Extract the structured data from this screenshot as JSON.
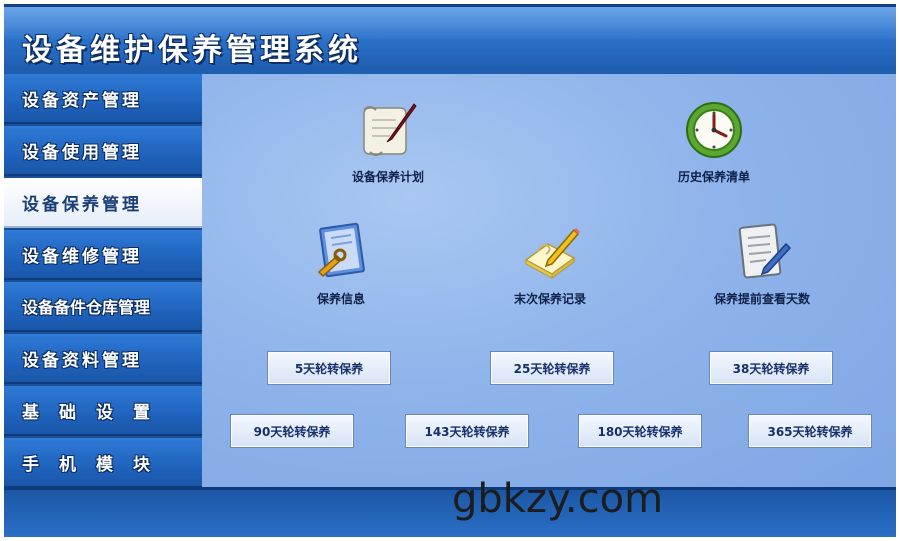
{
  "app": {
    "title": "设备维护保养管理系统"
  },
  "sidebar": {
    "items": [
      {
        "label": "设备资产管理"
      },
      {
        "label": "设备使用管理"
      },
      {
        "label": "设备保养管理"
      },
      {
        "label": "设备维修管理"
      },
      {
        "label": "设备备件仓库管理"
      },
      {
        "label": "设备资料管理"
      },
      {
        "label": "基础设置"
      },
      {
        "label": "手机模块"
      }
    ],
    "active_index": 2
  },
  "modules": {
    "plan": {
      "label": "设备保养计划",
      "icon": "scroll-quill-icon"
    },
    "history": {
      "label": "历史保养清单",
      "icon": "clock-icon"
    },
    "info": {
      "label": "保养信息",
      "icon": "document-wrench-icon"
    },
    "last_record": {
      "label": "末次保养记录",
      "icon": "notepad-pencil-icon"
    },
    "advance_days": {
      "label": "保养提前查看天数",
      "icon": "clipboard-pen-icon"
    }
  },
  "rotation_buttons": [
    {
      "label": "5天轮转保养"
    },
    {
      "label": "25天轮转保养"
    },
    {
      "label": "38天轮转保养"
    },
    {
      "label": "90天轮转保养"
    },
    {
      "label": "143天轮转保养"
    },
    {
      "label": "180天轮转保养"
    },
    {
      "label": "365天轮转保养"
    }
  ],
  "watermark": "gbkzy.com",
  "colors": {
    "accent": "#2a70c8",
    "content_bg": "#8fb4eb",
    "active_nav": "#ffffff"
  }
}
